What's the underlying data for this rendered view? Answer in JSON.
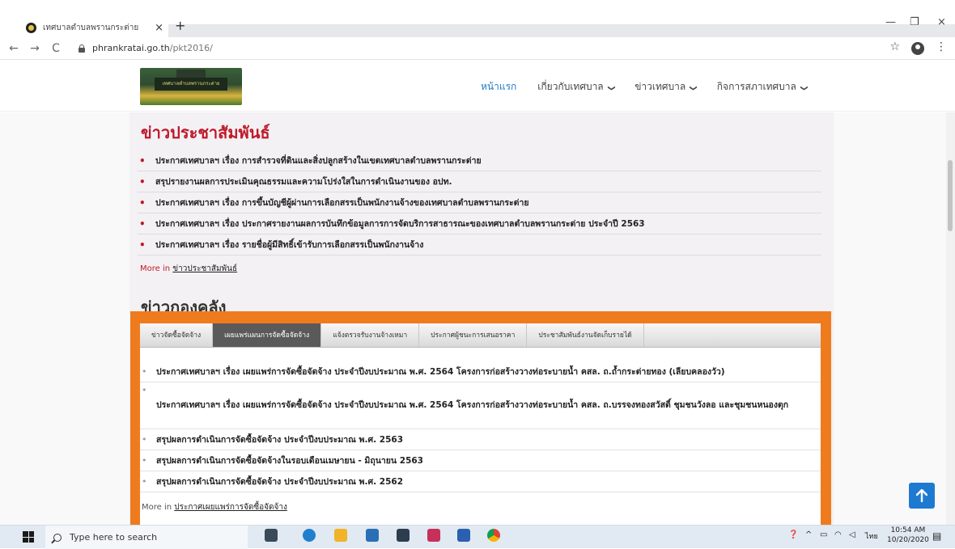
{
  "browser": {
    "tab_title": "เทศบาลตำบลพรานกระต่าย",
    "tab_close": "×",
    "new_tab": "+",
    "url_host": "phrankratai.go.th",
    "url_path": "/pkt2016/",
    "nav": {
      "back": "←",
      "forward": "→",
      "reload": "C"
    },
    "window": {
      "minimize": "—",
      "restore": "❐",
      "close": "×"
    },
    "star": "☆",
    "menu": "⋮"
  },
  "header": {
    "logo_sign": "เทศบาลตำบลพรานกระต่าย",
    "nav": [
      {
        "label": "หน้าแรก",
        "active": true,
        "dropdown": false
      },
      {
        "label": "เกี่ยวกับเทศบาล",
        "active": false,
        "dropdown": true
      },
      {
        "label": "ข่าวเทศบาล",
        "active": false,
        "dropdown": true
      },
      {
        "label": "กิจการสภาเทศบาล",
        "active": false,
        "dropdown": true
      }
    ]
  },
  "pr_section": {
    "title": "ข่าวประชาสัมพันธ์",
    "items": [
      "ประกาศเทศบาลฯ เรื่อง การสำรวจที่ดินและสิ่งปลูกสร้างในเขตเทศบาลตำบลพรานกระต่าย",
      "สรุปรายงานผลการประเมินคุณธรรมและความโปร่งใสในการดำเนินงานของ อปท.",
      "ประกาศเทศบาลฯ เรื่อง การขึ้นบัญชีผู้ผ่านการเลือกสรรเป็นพนักงานจ้างของเทศบาลตำบลพรานกระต่าย",
      "ประกาศเทศบาลฯ เรื่อง ประกาศรายงานผลการบันทึกข้อมูลการการจัดบริการสาธารณะของเทศบาลตำบลพรานกระต่าย ประจำปี 2563",
      "ประกาศเทศบาลฯ เรื่อง รายชื่อผู้มีสิทธิ์เข้ารับการเลือกสรรเป็นพนักงานจ้าง"
    ],
    "more_prefix": "More in",
    "more_link": "ข่าวประชาสัมพันธ์"
  },
  "finance_section": {
    "title": "ข่าวกองคลัง",
    "tabs": [
      {
        "label": "ข่าวจัดซื้อจัดจ้าง",
        "active": false
      },
      {
        "label": "เผยแพร่แผนการจัดซื้อจัดจ้าง",
        "active": true
      },
      {
        "label": "แจ้งตรวจรับงานจ้างเหมา",
        "active": false
      },
      {
        "label": "ประกาศผู้ชนะการเสนอราคา",
        "active": false
      },
      {
        "label": "ประชาสัมพันธ์งานจัดเก็บรายได้",
        "active": false
      }
    ],
    "items": [
      "ประกาศเทศบาลฯ เรื่อง เผยแพร่การจัดซื้อจัดจ้าง ประจำปีงบประมาณ พ.ศ. 2564 โครงการก่อสร้างวางท่อระบายน้ำ คสล. ถ.ถ้ำกระต่ายทอง (เลียบคลองวัว)",
      "ประกาศเทศบาลฯ เรื่อง เผยแพร่การจัดซื้อจัดจ้าง ประจำปีงบประมาณ พ.ศ. 2564 โครงการก่อสร้างวางท่อระบายน้ำ คสล. ถ.บรรจงทองสวัสดิ์ ชุมชนวังลอ และชุมชนหนองตุก",
      "สรุปผลการดำเนินการจัดซื้อจัดจ้าง ประจำปีงบประมาณ พ.ศ. 2563",
      "สรุปผลการดำเนินการจัดซื้อจัดจ้างในรอบเดือนเมษายน - มิถุนายน 2563",
      "สรุปผลการดำเนินการจัดซื้อจัดจ้าง ประจำปีงบประมาณ พ.ศ. 2562"
    ],
    "more_prefix": "More in",
    "more_link": "ประกาศเผยแพร่การจัดซื้อจัดจ้าง"
  },
  "taskbar": {
    "search_placeholder": "Type here to search",
    "lang": "ไทย",
    "time": "10:54 AM",
    "date": "10/20/2020"
  },
  "colors": {
    "accent_red": "#c0192b",
    "orange_frame": "#ef7b1f",
    "nav_active": "#1e79c7",
    "to_top_button": "#1e7ad1"
  }
}
